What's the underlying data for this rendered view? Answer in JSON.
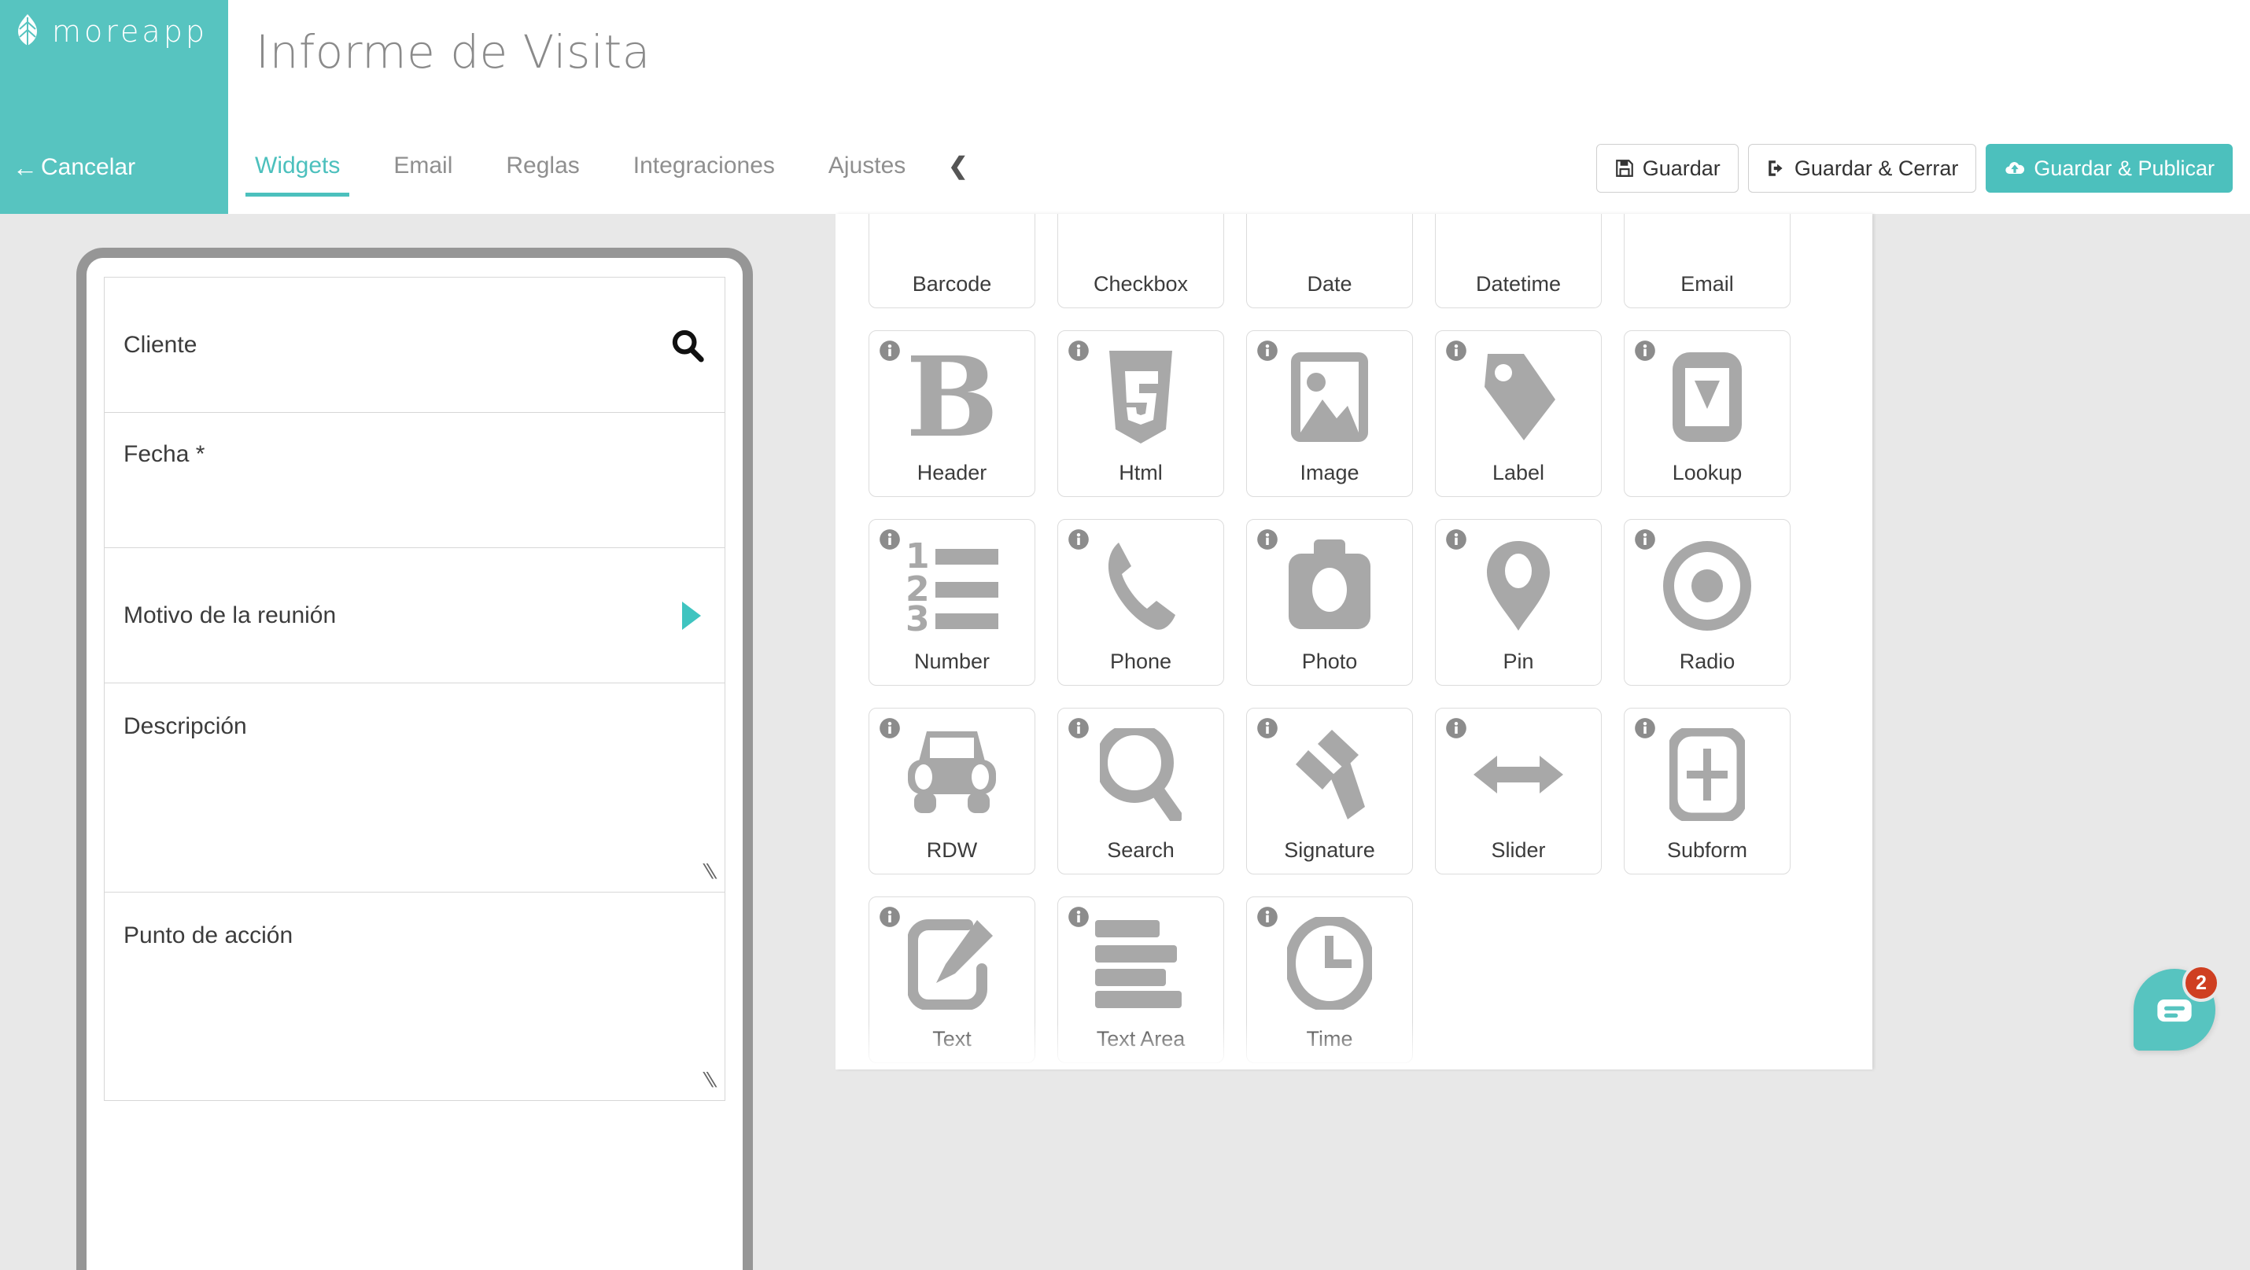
{
  "brand": {
    "name": "moreapp",
    "logo_icon": "leaf-icon",
    "cancel_label": "Cancelar",
    "cancel_icon": "arrow-left-icon",
    "color": "#57c4c0"
  },
  "header": {
    "title": "Informe de Visita",
    "tabs": [
      {
        "label": "Widgets",
        "active": true
      },
      {
        "label": "Email",
        "active": false
      },
      {
        "label": "Reglas",
        "active": false
      },
      {
        "label": "Integraciones",
        "active": false
      },
      {
        "label": "Ajustes",
        "active": false
      }
    ],
    "collapse_icon": "chevron-left-icon",
    "actions": [
      {
        "label": "Guardar",
        "icon": "floppy-disk-icon",
        "primary": false
      },
      {
        "label": "Guardar & Cerrar",
        "icon": "sign-out-icon",
        "primary": false
      },
      {
        "label": "Guardar & Publicar",
        "icon": "cloud-upload-icon",
        "primary": true
      }
    ],
    "accent_color": "#4cc0bd"
  },
  "preview": {
    "fields": [
      {
        "label": "Cliente",
        "type": "search",
        "icon": "search-icon"
      },
      {
        "label": "Fecha *",
        "type": "date",
        "icon": ""
      },
      {
        "label": "Motivo de la reunión",
        "type": "lookup",
        "icon": "play-triangle-icon"
      },
      {
        "label": "Descripción",
        "type": "textarea",
        "icon": "resize-grip-icon"
      },
      {
        "label": "Punto de acción",
        "type": "textarea",
        "icon": "resize-grip-icon"
      }
    ]
  },
  "widgets": {
    "info_icon": "info-circle-icon",
    "items": [
      {
        "label": "Barcode",
        "icon": "barcode-icon",
        "clipped": true
      },
      {
        "label": "Checkbox",
        "icon": "checkbox-icon",
        "clipped": true
      },
      {
        "label": "Date",
        "icon": "calendar-icon",
        "clipped": true
      },
      {
        "label": "Datetime",
        "icon": "calendar-clock-icon",
        "clipped": true
      },
      {
        "label": "Email",
        "icon": "envelope-icon",
        "clipped": true
      },
      {
        "label": "Header",
        "icon": "bold-b-icon",
        "clipped": false
      },
      {
        "label": "Html",
        "icon": "html5-shield-icon",
        "clipped": false
      },
      {
        "label": "Image",
        "icon": "image-icon",
        "clipped": false
      },
      {
        "label": "Label",
        "icon": "tag-icon",
        "clipped": false
      },
      {
        "label": "Lookup",
        "icon": "dropdown-icon",
        "clipped": false
      },
      {
        "label": "Number",
        "icon": "numbered-list-icon",
        "clipped": false
      },
      {
        "label": "Phone",
        "icon": "phone-icon",
        "clipped": false
      },
      {
        "label": "Photo",
        "icon": "camera-icon",
        "clipped": false
      },
      {
        "label": "Pin",
        "icon": "map-pin-icon",
        "clipped": false
      },
      {
        "label": "Radio",
        "icon": "radio-button-icon",
        "clipped": false
      },
      {
        "label": "RDW",
        "icon": "car-icon",
        "clipped": false
      },
      {
        "label": "Search",
        "icon": "magnifier-icon",
        "clipped": false
      },
      {
        "label": "Signature",
        "icon": "gavel-pen-icon",
        "clipped": false
      },
      {
        "label": "Slider",
        "icon": "arrows-horizontal-icon",
        "clipped": false
      },
      {
        "label": "Subform",
        "icon": "plus-box-icon",
        "clipped": false
      },
      {
        "label": "Text",
        "icon": "pencil-edit-icon",
        "clipped": false
      },
      {
        "label": "Text Area",
        "icon": "text-lines-icon",
        "clipped": false
      },
      {
        "label": "Time",
        "icon": "clock-icon",
        "clipped": false
      }
    ]
  },
  "chat": {
    "icon": "chat-bubble-icon",
    "badge_count": "2",
    "badge_color": "#cf3f21",
    "button_color": "#57c4c0"
  }
}
